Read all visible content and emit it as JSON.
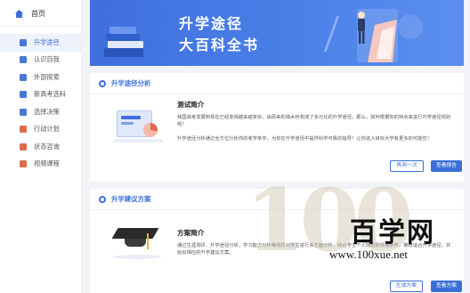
{
  "sidebar": {
    "home_label": "首页",
    "items": [
      {
        "label": "升学途径",
        "icon": "route-icon",
        "active": true
      },
      {
        "label": "认识自我",
        "icon": "person-icon"
      },
      {
        "label": "外部探索",
        "icon": "explore-icon"
      },
      {
        "label": "新高考选科",
        "icon": "book-icon"
      },
      {
        "label": "选择决策",
        "icon": "decision-icon"
      },
      {
        "label": "行动计划",
        "icon": "plan-icon"
      },
      {
        "label": "状态咨询",
        "icon": "consult-icon"
      },
      {
        "label": "视频课程",
        "icon": "video-icon"
      }
    ]
  },
  "banner": {
    "line1": "升学途径",
    "line2": "大百科全书"
  },
  "section1": {
    "header": "升学途径分析",
    "title": "测试简介",
    "text_a": "我国高考发展到现在已经变得越来越复杂，由原来的独木桥变成了多元化的升学途径。那么，如何根据你的特点来进行升学途径规划呢？",
    "text_b": "升学途径分析通过全方位分析你的考学条件，为你在升学途径中提供科学可靠的指导！让你进入目标大学有更多的可能性！",
    "btn_retest": "再测一次",
    "btn_report": "查看报告"
  },
  "section2": {
    "header": "升学建议方案",
    "title": "方案简介",
    "text_a": "通过生涯测评、升学途径分析、学习能力分析等测评对学生进行多方面分析，综合学生个人情况和现有条件，推荐适合升学途径，并给出相应的升学建议方案。",
    "btn_generate": "生成方案",
    "btn_view": "查看方案"
  },
  "watermark": {
    "number": "100",
    "name": "百学网",
    "url": "www.100xue.net"
  },
  "colors": {
    "accent": "#3b6fd7",
    "banner": "#4a80e8",
    "background": "#f2f3f7"
  }
}
